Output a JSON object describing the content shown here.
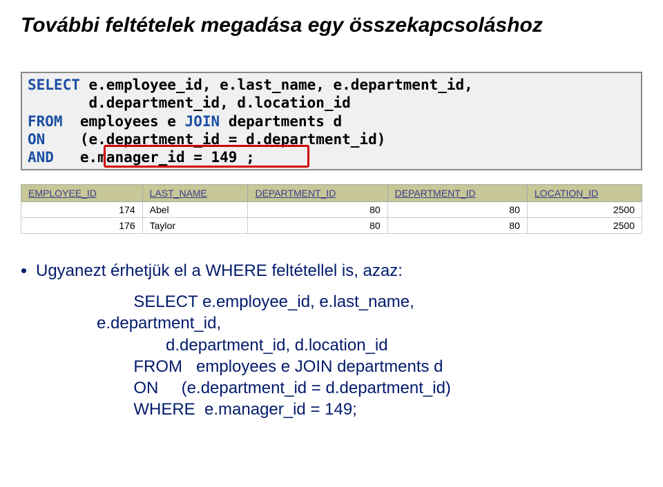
{
  "title": "További feltételek megadása egy összekapcsoláshoz",
  "code1": {
    "l1a": "SELECT",
    "l1b": "e.employee_id, e.last_name, e.department_id,",
    "l2": "       d.department_id, d.location_id",
    "l3a": "FROM",
    "l3b": "  employees e ",
    "l3c": "JOIN",
    "l3d": " departments d",
    "l4a": "ON",
    "l4b": "    (e.department_id = d.department_id)",
    "l5a": "AND",
    "l5b": "   e.manager_id = 149 ;"
  },
  "table": {
    "headers": [
      "EMPLOYEE_ID",
      "LAST_NAME",
      "DEPARTMENT_ID",
      "DEPARTMENT_ID",
      "LOCATION_ID"
    ],
    "rows": [
      [
        "174",
        "Abel",
        "80",
        "80",
        "2500"
      ],
      [
        "176",
        "Taylor",
        "80",
        "80",
        "2500"
      ]
    ]
  },
  "bullet": "Ugyanezt érhetjük el a WHERE feltétellel is, azaz:",
  "code2": {
    "l1": "        SELECT e.employee_id, e.last_name,",
    "l2": "e.department_id,",
    "l3": "               d.department_id, d.location_id",
    "l4": "        FROM   employees e JOIN departments d",
    "l5": "        ON     (e.department_id = d.department_id)",
    "l6": "        WHERE  e.manager_id = 149;"
  }
}
